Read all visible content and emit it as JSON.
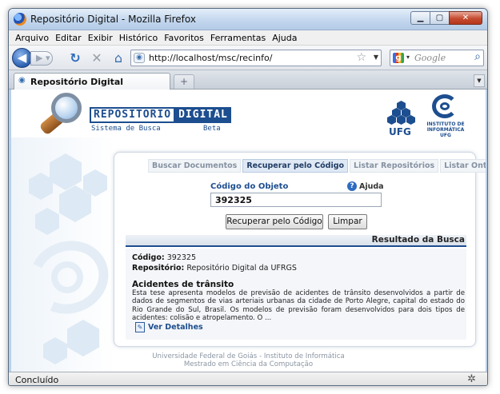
{
  "window": {
    "title": "Repositório Digital - Mozilla Firefox",
    "buttons": {
      "minimize": "▁",
      "maximize": "▢",
      "close": "✕"
    }
  },
  "menubar": {
    "items": [
      {
        "label": "Arquivo"
      },
      {
        "label": "Editar"
      },
      {
        "label": "Exibir"
      },
      {
        "label": "Histórico"
      },
      {
        "label": "Favoritos"
      },
      {
        "label": "Ferramentas"
      },
      {
        "label": "Ajuda"
      }
    ]
  },
  "navbar": {
    "url": "http://localhost/msc/recinfo/",
    "search_placeholder": "Google",
    "icons": [
      "back-icon",
      "forward-icon",
      "reload-icon",
      "stop-icon",
      "home-icon",
      "bookmark-star-icon",
      "google-icon",
      "magnifier-icon"
    ]
  },
  "tabs": {
    "active_label": "Repositório Digital",
    "new_tab": "+"
  },
  "header": {
    "logo_part1": "REPOSITÓRIO",
    "logo_part2": "DIGITAL",
    "subtitle": "Sistema de Busca",
    "beta": "Beta",
    "ufg": "UFG",
    "inf_line1": "INSTITUTO DE",
    "inf_line2": "INFORMÁTICA",
    "inf_line3": "UFG"
  },
  "panel": {
    "tabs": [
      {
        "label": "Buscar Documentos"
      },
      {
        "label": "Recuperar pelo Código"
      },
      {
        "label": "Listar Repositórios"
      },
      {
        "label": "Listar Ontologias"
      }
    ],
    "active_tab": "Recuperar pelo Código",
    "code_label": "Código do Objeto",
    "help_label": "Ajuda",
    "code_value": "392325",
    "retrieve_button": "Recuperar pelo Código",
    "clear_button": "Limpar",
    "result_title": "Resultado da Busca",
    "result": {
      "code_label": "Código:",
      "code_value": "392325",
      "repo_label": "Repositório:",
      "repo_value": "Repositório Digital da UFRGS",
      "doc_title": "Acidentes de trânsito",
      "abstract": "Esta tese apresenta modelos de previsão de acidentes de trânsito desenvolvidos a partir de dados de segmentos de vias arteriais urbanas da cidade de Porto Alegre, capital do estado do Rio Grande do Sul, Brasil. Os modelos de previsão foram desenvolvidos para dois tipos de acidentes: colisão e atropelamento. O ...",
      "details_label": "Ver Detalhes"
    }
  },
  "footer": {
    "line1": "Universidade Federal de Goiás - Instituto de Informática",
    "line2": "Mestrado em Ciência da Computação"
  },
  "statusbar": {
    "text": "Concluído"
  }
}
